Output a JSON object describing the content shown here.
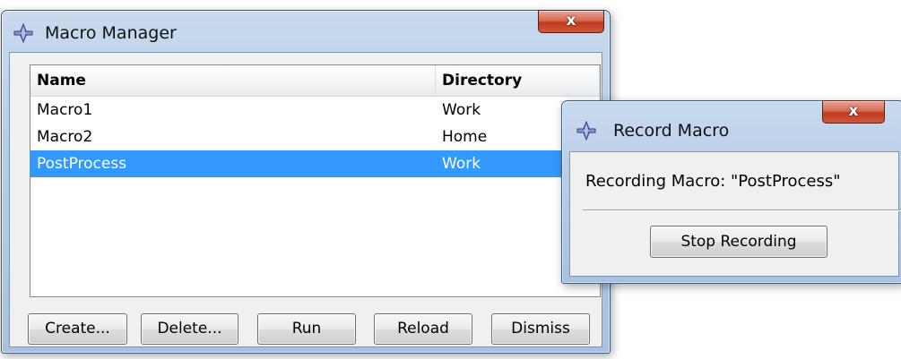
{
  "macro_manager": {
    "title": "Macro Manager",
    "close_glyph": "x",
    "columns": {
      "name": "Name",
      "directory": "Directory"
    },
    "rows": [
      {
        "name": "Macro1",
        "directory": "Work",
        "selected": false
      },
      {
        "name": "Macro2",
        "directory": "Home",
        "selected": false
      },
      {
        "name": "PostProcess",
        "directory": "Work",
        "selected": true
      }
    ],
    "buttons": {
      "create": "Create...",
      "delete": "Delete...",
      "run": "Run",
      "reload": "Reload",
      "dismiss": "Dismiss"
    },
    "icon": "abaqus-app-icon"
  },
  "record_macro": {
    "title": "Record Macro",
    "close_glyph": "x",
    "status_text": "Recording Macro: \"PostProcess\"",
    "stop_button": "Stop Recording",
    "icon": "abaqus-app-icon"
  },
  "colors": {
    "selection": "#3399ff",
    "close_button": "#c0391f",
    "frame": "#b8cde6"
  }
}
